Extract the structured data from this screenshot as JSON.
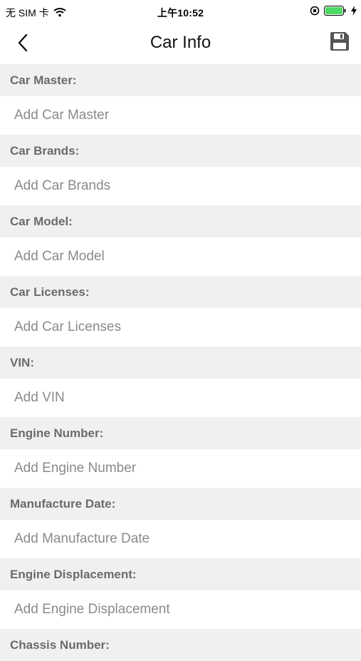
{
  "statusbar": {
    "carrier": "无 SIM 卡",
    "time": "上午10:52"
  },
  "navbar": {
    "title": "Car Info",
    "back_icon": "chevron-left-icon",
    "save_icon": "floppy-disk-icon"
  },
  "fields": [
    {
      "label": "Car Master:",
      "placeholder": "Add Car Master"
    },
    {
      "label": "Car Brands:",
      "placeholder": "Add Car Brands"
    },
    {
      "label": "Car Model:",
      "placeholder": "Add Car Model"
    },
    {
      "label": "Car Licenses:",
      "placeholder": "Add Car Licenses"
    },
    {
      "label": "VIN:",
      "placeholder": "Add VIN"
    },
    {
      "label": "Engine Number:",
      "placeholder": "Add Engine Number"
    },
    {
      "label": "Manufacture Date:",
      "placeholder": "Add Manufacture Date"
    },
    {
      "label": "Engine Displacement:",
      "placeholder": "Add Engine Displacement"
    },
    {
      "label": "Chassis Number:",
      "placeholder": ""
    }
  ],
  "colors": {
    "section_bg": "#f0f0f0",
    "label_text": "#6b6b6b",
    "placeholder_text": "#8a8a8a",
    "save_icon": "#555555",
    "battery_fill": "#4cd964"
  }
}
